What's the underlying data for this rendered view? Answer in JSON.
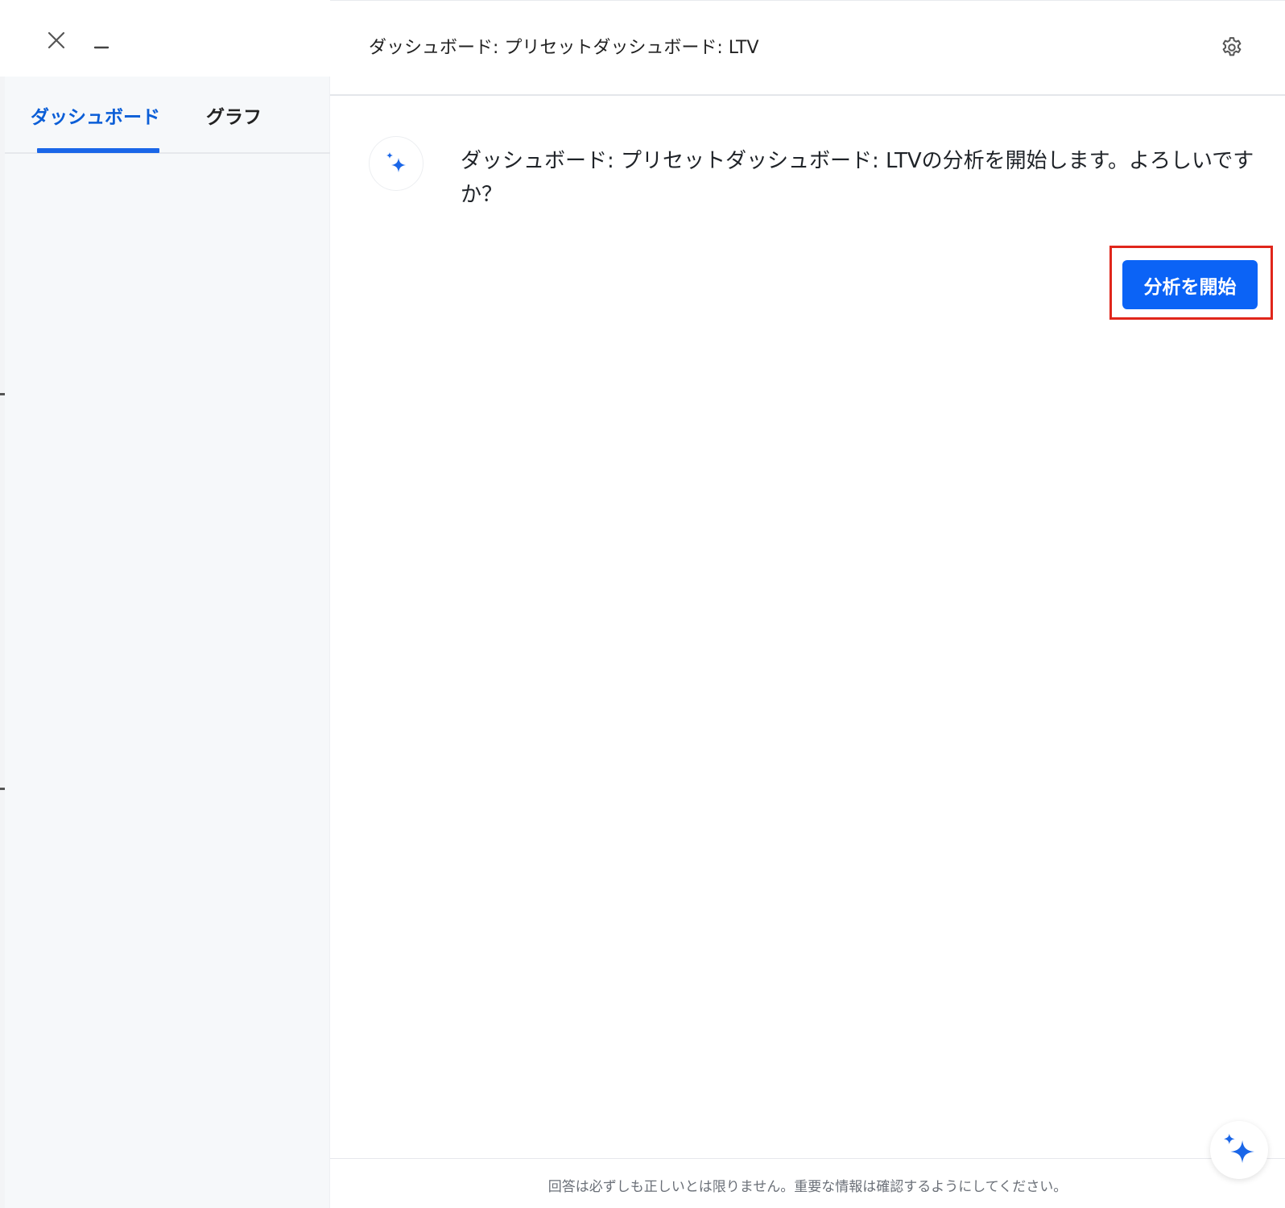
{
  "window": {
    "close_icon": "close-icon",
    "minimize_icon": "minimize-icon"
  },
  "sidebar": {
    "tabs": [
      {
        "label": "ダッシュボード",
        "active": true
      },
      {
        "label": "グラフ",
        "active": false
      }
    ]
  },
  "header": {
    "title": "ダッシュボード: プリセットダッシュボード: LTV",
    "settings_icon": "gear-icon"
  },
  "chat": {
    "avatar_icon": "sparkle-icon",
    "message": "ダッシュボード: プリセットダッシュボード: LTVの分析を開始します。よろしいですか？",
    "start_button_label": "分析を開始"
  },
  "footer": {
    "disclaimer": "回答は必ずしも正しいとは限りません。重要な情報は確認するようにしてください。"
  },
  "fab": {
    "icon": "sparkle-icon"
  },
  "colors": {
    "accent": "#0b63f6",
    "tab_active": "#0b5ed7",
    "highlight": "#e0261b",
    "sidebar_bg": "#f6f8fa"
  }
}
